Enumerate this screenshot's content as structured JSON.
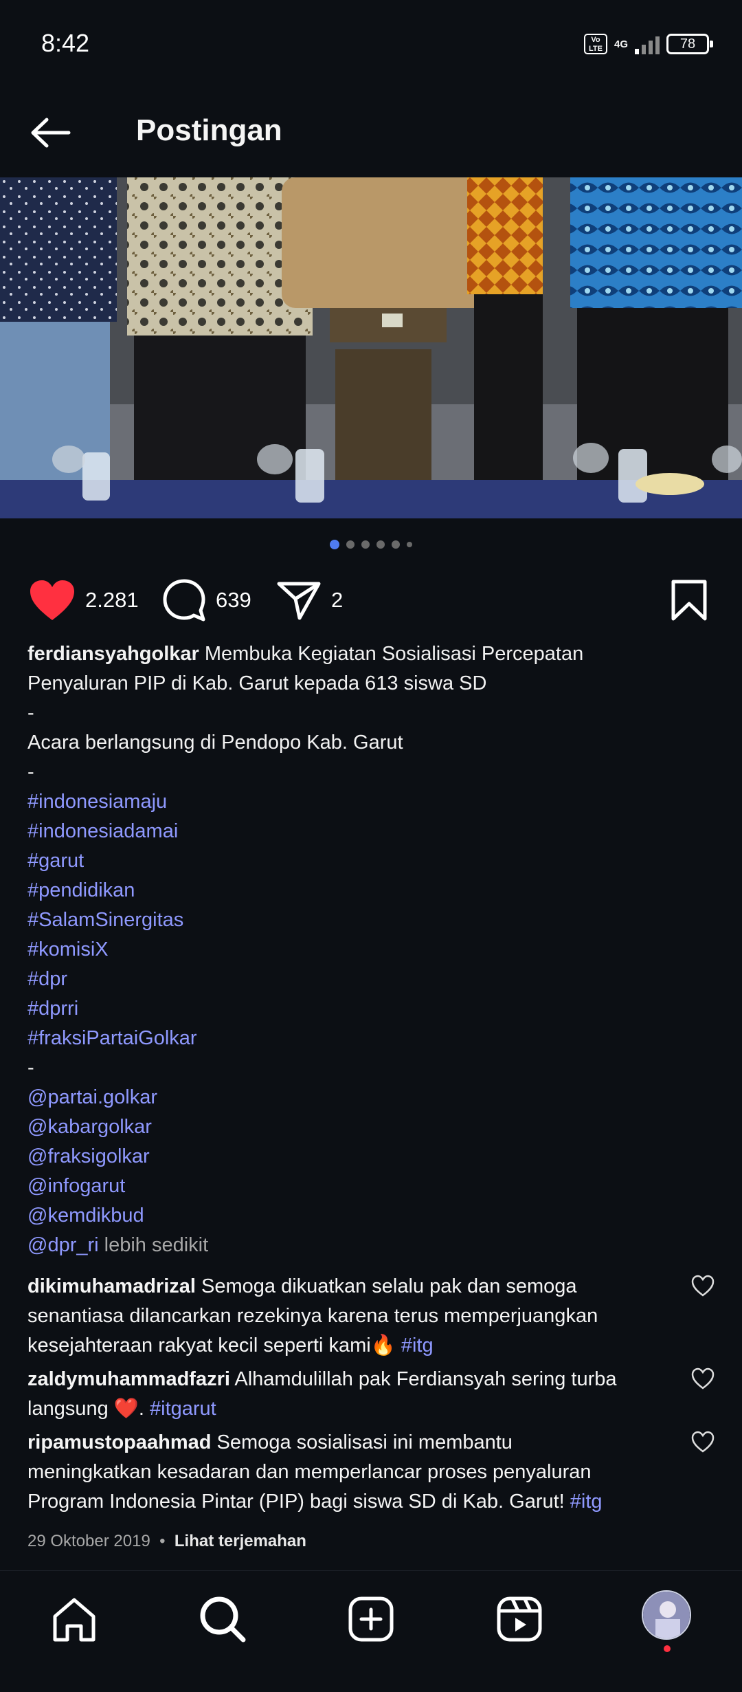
{
  "status": {
    "time": "8:42",
    "volte_top": "Vo",
    "volte_bottom": "LTE",
    "network": "4G",
    "battery": "78"
  },
  "header": {
    "title": "Postingan"
  },
  "actions": {
    "likes": "2.281",
    "comments": "639",
    "shares": "2"
  },
  "caption": {
    "username": "ferdiansyahgolkar",
    "line1": " Membuka Kegiatan Sosialisasi Percepatan",
    "line2": "Penyaluran PIP di Kab. Garut kepada 613 siswa SD",
    "dash": "-",
    "line3": "Acara berlangsung di Pendopo Kab. Garut",
    "hashtags": [
      "#indonesiamaju",
      "#indonesiadamai",
      "#garut",
      "#pendidikan",
      "#SalamSinergitas",
      "#komisiX",
      "#dpr",
      "#dprri",
      "#fraksiPartaiGolkar"
    ],
    "mentions": [
      "@partai.golkar",
      "@kabargolkar",
      "@fraksigolkar",
      "@infogarut",
      "@kemdikbud",
      "@dpr_ri"
    ],
    "less": " lebih sedikit"
  },
  "comments": [
    {
      "user": "dikimuhamadrizal",
      "l1": " Semoga dikuatkan selalu pak dan semoga",
      "l2": "senantiasa dilancarkan rezekinya karena terus memperjuangkan",
      "l3": "kesejahteraan rakyat kecil seperti kami",
      "emoji": "🔥",
      "tag": " #itg"
    },
    {
      "user": "zaldymuhammadfazri",
      "l1": " Alhamdulillah pak Ferdiansyah sering turba",
      "l2": "langsung ",
      "emoji": "❤️",
      "mid": ". ",
      "tag": "#itgarut"
    },
    {
      "user": "ripamustopaahmad",
      "l1": " Semoga sosialisasi ini membantu",
      "l2": "meningkatkan kesadaran dan memperlancar proses penyaluran",
      "l3": "Program Indonesia Pintar (PIP) bagi siswa SD di Kab. Garut! ",
      "tag": "#itg"
    }
  ],
  "meta": {
    "date": "29 Oktober 2019",
    "sep": "•",
    "translate": "Lihat terjemahan"
  },
  "colors": {
    "background": "#0c0f14",
    "like": "#ff3040",
    "link": "#8f99ff",
    "dot_active": "#4f7cf0"
  },
  "icons": [
    "back-arrow-icon",
    "heart-icon",
    "comment-icon",
    "share-icon",
    "bookmark-icon",
    "home-icon",
    "search-icon",
    "add-icon",
    "reels-icon"
  ]
}
